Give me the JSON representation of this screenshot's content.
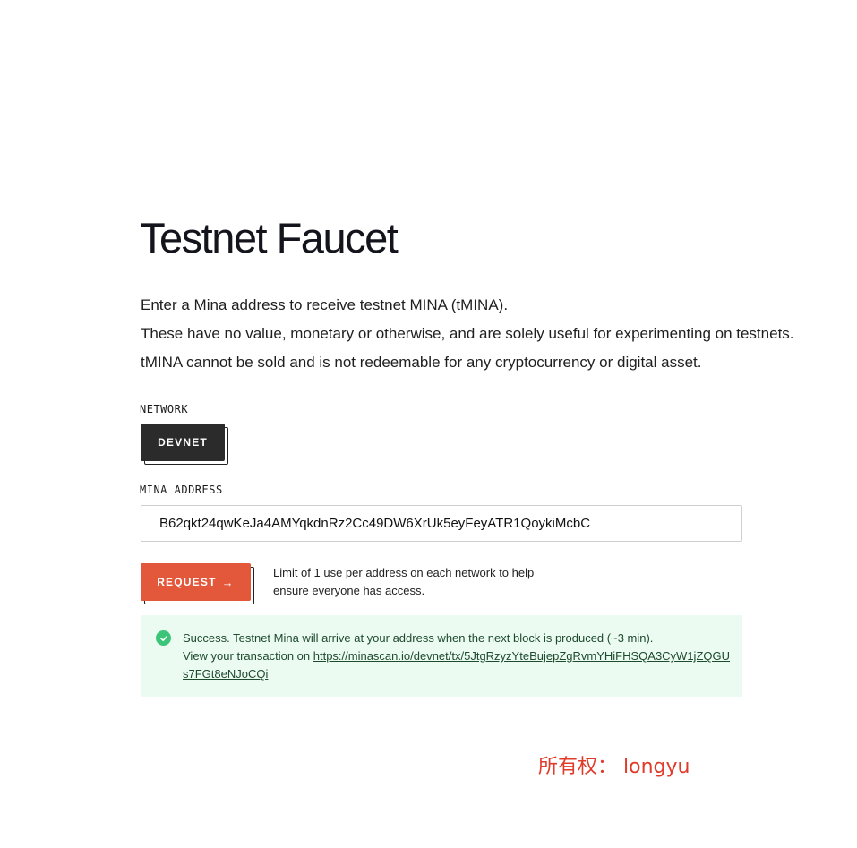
{
  "page": {
    "title": "Testnet Faucet",
    "description": [
      "Enter a Mina address to receive testnet MINA (tMINA).",
      "These have no value, monetary or otherwise, and are solely useful for experimenting on testnets.",
      "tMINA cannot be sold and is not redeemable for any cryptocurrency or digital asset."
    ]
  },
  "network": {
    "label": "NETWORK",
    "selected": "DEVNET"
  },
  "address": {
    "label": "MINA ADDRESS",
    "value": "B62qkt24qwKeJa4AMYqkdnRz2Cc49DW6XrUk5eyFeyATR1QoykiMcbC"
  },
  "request": {
    "button_label": "REQUEST",
    "arrow_icon": "arrow-right-icon",
    "limit_note": "Limit of 1 use per address on each network to help ensure everyone has access."
  },
  "success": {
    "icon": "check-circle-icon",
    "message": "Success. Testnet Mina will arrive at your address when the next block is produced (~3 min).",
    "link_prefix": "View your transaction on ",
    "link_url": "https://minascan.io/devnet/tx/5JtgRzyzYteBujepZgRvmYHiFHSQA3CyW1jZQGUs7FGt8eNJoCQi"
  },
  "watermark": "所有权：  longyu",
  "colors": {
    "accent": "#e3573b",
    "dark_button": "#2b2b2b",
    "success_bg": "#ecfbf1",
    "success_icon": "#3cc478",
    "watermark": "#e03a2a"
  }
}
